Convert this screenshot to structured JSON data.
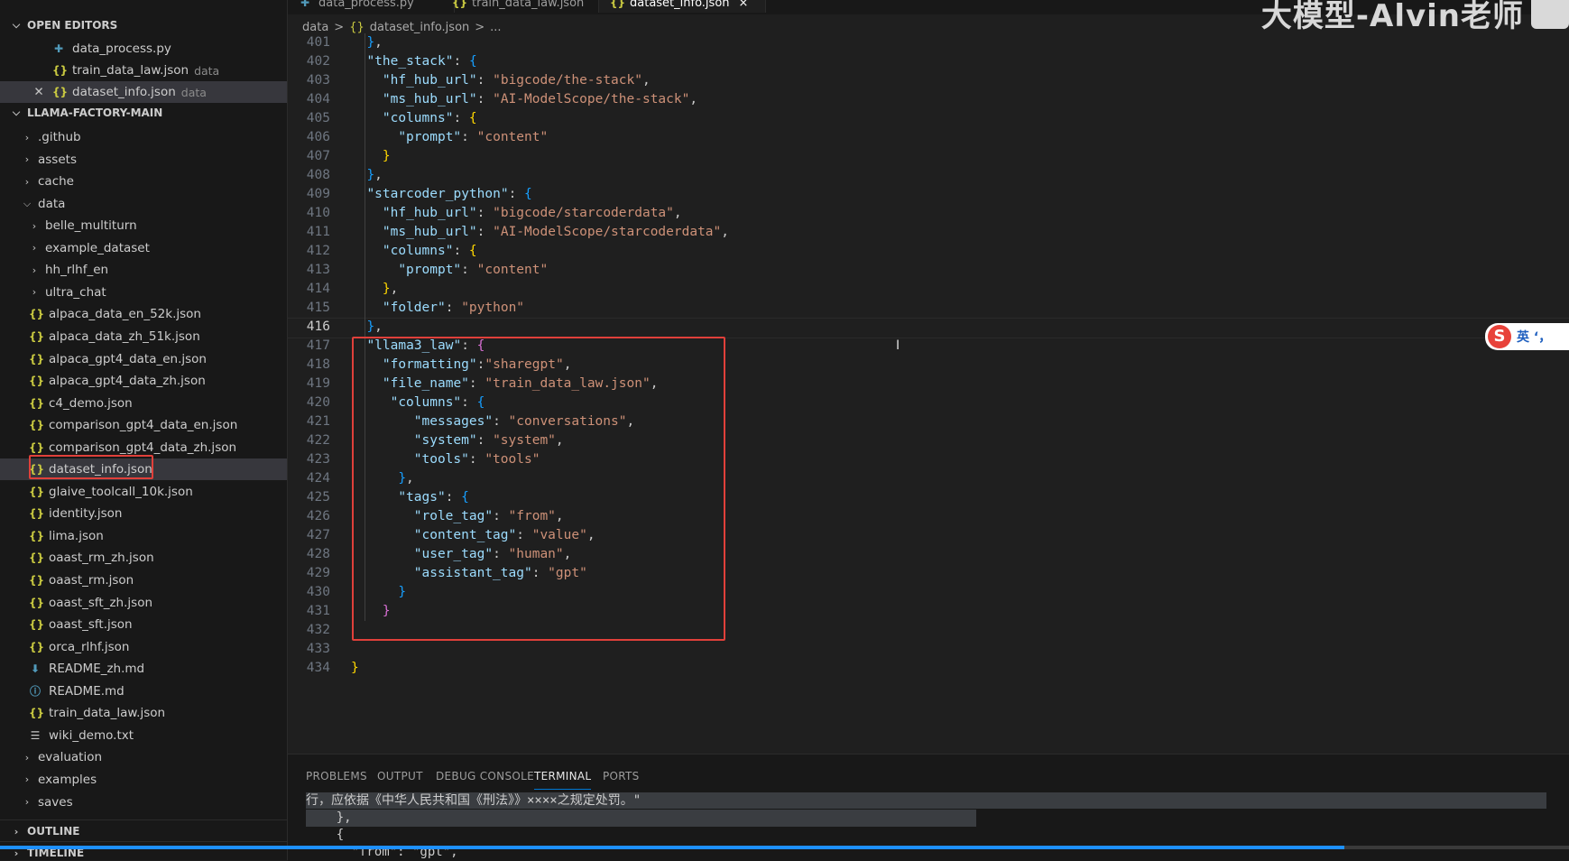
{
  "tabs": [
    {
      "label": "data_process.py",
      "icon": "python-file-icon"
    },
    {
      "label": "train_data_law.json",
      "icon": "json-file-icon"
    },
    {
      "label": "dataset_info.json",
      "icon": "json-file-icon",
      "close": "×"
    }
  ],
  "breadcrumb": {
    "folder": "data",
    "sep1": ">",
    "file_icon": "{}",
    "file": "dataset_info.json",
    "sep2": ">",
    "tail": "..."
  },
  "watermark": "大模型-Alvin老师",
  "sidebar": {
    "open_editors_title": "OPEN EDITORS",
    "open_editors": [
      {
        "icon": "python-file-icon",
        "glyph": "✚",
        "name": "data_process.py",
        "desc": ""
      },
      {
        "icon": "json-file-icon",
        "glyph": "{}",
        "name": "train_data_law.json",
        "desc": "data"
      },
      {
        "icon": "json-file-icon",
        "glyph": "{}",
        "name": "dataset_info.json",
        "desc": "data",
        "close": "✕"
      }
    ],
    "project_title": "LLAMA-FACTORY-MAIN",
    "tree": [
      {
        "type": "folder",
        "name": ".github",
        "level": 1
      },
      {
        "type": "folder",
        "name": "assets",
        "level": 1
      },
      {
        "type": "folder",
        "name": "cache",
        "level": 1
      },
      {
        "type": "folder-open",
        "name": "data",
        "level": 1
      },
      {
        "type": "folder",
        "name": "belle_multiturn",
        "level": 2
      },
      {
        "type": "folder",
        "name": "example_dataset",
        "level": 2
      },
      {
        "type": "folder",
        "name": "hh_rlhf_en",
        "level": 2
      },
      {
        "type": "folder",
        "name": "ultra_chat",
        "level": 2
      },
      {
        "type": "json",
        "name": "alpaca_data_en_52k.json",
        "level": 2
      },
      {
        "type": "json",
        "name": "alpaca_data_zh_51k.json",
        "level": 2
      },
      {
        "type": "json",
        "name": "alpaca_gpt4_data_en.json",
        "level": 2
      },
      {
        "type": "json",
        "name": "alpaca_gpt4_data_zh.json",
        "level": 2
      },
      {
        "type": "json",
        "name": "c4_demo.json",
        "level": 2
      },
      {
        "type": "json",
        "name": "comparison_gpt4_data_en.json",
        "level": 2
      },
      {
        "type": "json",
        "name": "comparison_gpt4_data_zh.json",
        "level": 2
      },
      {
        "type": "json",
        "name": "dataset_info.json",
        "level": 2,
        "selected": true
      },
      {
        "type": "json",
        "name": "glaive_toolcall_10k.json",
        "level": 2
      },
      {
        "type": "json",
        "name": "identity.json",
        "level": 2
      },
      {
        "type": "json",
        "name": "lima.json",
        "level": 2
      },
      {
        "type": "json",
        "name": "oaast_rm_zh.json",
        "level": 2
      },
      {
        "type": "json",
        "name": "oaast_rm.json",
        "level": 2
      },
      {
        "type": "json",
        "name": "oaast_sft_zh.json",
        "level": 2
      },
      {
        "type": "json",
        "name": "oaast_sft.json",
        "level": 2
      },
      {
        "type": "json",
        "name": "orca_rlhf.json",
        "level": 2
      },
      {
        "type": "md-down",
        "name": "README_zh.md",
        "level": 2
      },
      {
        "type": "md-info",
        "name": "README.md",
        "level": 2
      },
      {
        "type": "json",
        "name": "train_data_law.json",
        "level": 2
      },
      {
        "type": "txt",
        "name": "wiki_demo.txt",
        "level": 2
      },
      {
        "type": "folder",
        "name": "evaluation",
        "level": 1
      },
      {
        "type": "folder",
        "name": "examples",
        "level": 1
      },
      {
        "type": "folder",
        "name": "saves",
        "level": 1
      }
    ],
    "outline_title": "OUTLINE",
    "timeline_title": "TIMELINE"
  },
  "editor": {
    "current_line": 416,
    "lines": [
      {
        "n": 401,
        "indent": 1,
        "t": [
          [
            "b2",
            "}"
          ],
          [
            "p",
            ","
          ]
        ]
      },
      {
        "n": 402,
        "indent": 1,
        "t": [
          [
            "k",
            "\"the_stack\""
          ],
          [
            "p",
            ": "
          ],
          [
            "b2",
            "{"
          ]
        ]
      },
      {
        "n": 403,
        "indent": 2,
        "t": [
          [
            "k",
            "\"hf_hub_url\""
          ],
          [
            "p",
            ": "
          ],
          [
            "s",
            "\"bigcode/the-stack\""
          ],
          [
            "p",
            ","
          ]
        ]
      },
      {
        "n": 404,
        "indent": 2,
        "t": [
          [
            "k",
            "\"ms_hub_url\""
          ],
          [
            "p",
            ": "
          ],
          [
            "s",
            "\"AI-ModelScope/the-stack\""
          ],
          [
            "p",
            ","
          ]
        ]
      },
      {
        "n": 405,
        "indent": 2,
        "t": [
          [
            "k",
            "\"columns\""
          ],
          [
            "p",
            ": "
          ],
          [
            "b3",
            "{"
          ]
        ]
      },
      {
        "n": 406,
        "indent": 3,
        "t": [
          [
            "k",
            "\"prompt\""
          ],
          [
            "p",
            ": "
          ],
          [
            "s",
            "\"content\""
          ]
        ]
      },
      {
        "n": 407,
        "indent": 2,
        "t": [
          [
            "b3",
            "}"
          ]
        ]
      },
      {
        "n": 408,
        "indent": 1,
        "t": [
          [
            "b2",
            "}"
          ],
          [
            "p",
            ","
          ]
        ]
      },
      {
        "n": 409,
        "indent": 1,
        "t": [
          [
            "k",
            "\"starcoder_python\""
          ],
          [
            "p",
            ": "
          ],
          [
            "b2",
            "{"
          ]
        ]
      },
      {
        "n": 410,
        "indent": 2,
        "t": [
          [
            "k",
            "\"hf_hub_url\""
          ],
          [
            "p",
            ": "
          ],
          [
            "s",
            "\"bigcode/starcoderdata\""
          ],
          [
            "p",
            ","
          ]
        ]
      },
      {
        "n": 411,
        "indent": 2,
        "t": [
          [
            "k",
            "\"ms_hub_url\""
          ],
          [
            "p",
            ": "
          ],
          [
            "s",
            "\"AI-ModelScope/starcoderdata\""
          ],
          [
            "p",
            ","
          ]
        ]
      },
      {
        "n": 412,
        "indent": 2,
        "t": [
          [
            "k",
            "\"columns\""
          ],
          [
            "p",
            ": "
          ],
          [
            "b3",
            "{"
          ]
        ]
      },
      {
        "n": 413,
        "indent": 3,
        "t": [
          [
            "k",
            "\"prompt\""
          ],
          [
            "p",
            ": "
          ],
          [
            "s",
            "\"content\""
          ]
        ]
      },
      {
        "n": 414,
        "indent": 2,
        "t": [
          [
            "b3",
            "}"
          ],
          [
            "p",
            ","
          ]
        ]
      },
      {
        "n": 415,
        "indent": 2,
        "t": [
          [
            "k",
            "\"folder\""
          ],
          [
            "p",
            ": "
          ],
          [
            "s",
            "\"python\""
          ]
        ]
      },
      {
        "n": 416,
        "indent": 1,
        "t": [
          [
            "b2",
            "}"
          ],
          [
            "p",
            ","
          ]
        ]
      },
      {
        "n": 417,
        "indent": 1,
        "t": [
          [
            "k",
            "\"llama3_law\""
          ],
          [
            "p",
            ": "
          ],
          [
            "b1",
            "{"
          ]
        ]
      },
      {
        "n": 418,
        "indent": 2,
        "t": [
          [
            "k",
            "\"formatting\""
          ],
          [
            "p",
            ":"
          ],
          [
            "s",
            "\"sharegpt\""
          ],
          [
            "p",
            ","
          ]
        ]
      },
      {
        "n": 419,
        "indent": 2,
        "t": [
          [
            "k",
            "\"file_name\""
          ],
          [
            "p",
            ": "
          ],
          [
            "s",
            "\"train_data_law.json\""
          ],
          [
            "p",
            ","
          ]
        ]
      },
      {
        "n": 420,
        "indent": 2.5,
        "t": [
          [
            "k",
            "\"columns\""
          ],
          [
            "p",
            ": "
          ],
          [
            "b2",
            "{"
          ]
        ]
      },
      {
        "n": 421,
        "indent": 4,
        "t": [
          [
            "k",
            "\"messages\""
          ],
          [
            "p",
            ": "
          ],
          [
            "s",
            "\"conversations\""
          ],
          [
            "p",
            ","
          ]
        ]
      },
      {
        "n": 422,
        "indent": 4,
        "t": [
          [
            "k",
            "\"system\""
          ],
          [
            "p",
            ": "
          ],
          [
            "s",
            "\"system\""
          ],
          [
            "p",
            ","
          ]
        ]
      },
      {
        "n": 423,
        "indent": 4,
        "t": [
          [
            "k",
            "\"tools\""
          ],
          [
            "p",
            ": "
          ],
          [
            "s",
            "\"tools\""
          ]
        ]
      },
      {
        "n": 424,
        "indent": 3,
        "t": [
          [
            "b2",
            "}"
          ],
          [
            "p",
            ","
          ]
        ]
      },
      {
        "n": 425,
        "indent": 3,
        "t": [
          [
            "k",
            "\"tags\""
          ],
          [
            "p",
            ": "
          ],
          [
            "b2",
            "{"
          ]
        ]
      },
      {
        "n": 426,
        "indent": 4,
        "t": [
          [
            "k",
            "\"role_tag\""
          ],
          [
            "p",
            ": "
          ],
          [
            "s",
            "\"from\""
          ],
          [
            "p",
            ","
          ]
        ]
      },
      {
        "n": 427,
        "indent": 4,
        "t": [
          [
            "k",
            "\"content_tag\""
          ],
          [
            "p",
            ": "
          ],
          [
            "s",
            "\"value\""
          ],
          [
            "p",
            ","
          ]
        ]
      },
      {
        "n": 428,
        "indent": 4,
        "t": [
          [
            "k",
            "\"user_tag\""
          ],
          [
            "p",
            ": "
          ],
          [
            "s",
            "\"human\""
          ],
          [
            "p",
            ","
          ]
        ]
      },
      {
        "n": 429,
        "indent": 4,
        "t": [
          [
            "k",
            "\"assistant_tag\""
          ],
          [
            "p",
            ": "
          ],
          [
            "s",
            "\"gpt\""
          ]
        ]
      },
      {
        "n": 430,
        "indent": 3,
        "t": [
          [
            "b2",
            "}"
          ]
        ]
      },
      {
        "n": 431,
        "indent": 2,
        "t": [
          [
            "b1",
            "}"
          ]
        ]
      },
      {
        "n": 432,
        "indent": 0,
        "t": []
      },
      {
        "n": 433,
        "indent": 0,
        "t": []
      },
      {
        "n": 434,
        "indent": 0,
        "t": [
          [
            "b3",
            "}"
          ]
        ]
      }
    ]
  },
  "ime": {
    "logo": "S",
    "text": "英 ‘，"
  },
  "panel": {
    "tabs": [
      "PROBLEMS",
      "OUTPUT",
      "DEBUG CONSOLE",
      "TERMINAL",
      "PORTS"
    ],
    "active_tab": "TERMINAL",
    "terminal_lines": [
      "行，应依据《中华人民共和国《刑法》》××××之规定处罚。\"",
      "    },",
      "    {",
      "      \"from\": \"gpt\","
    ]
  },
  "colors": {
    "accent": "#0078d4",
    "highlight_box": "#e0403a"
  }
}
